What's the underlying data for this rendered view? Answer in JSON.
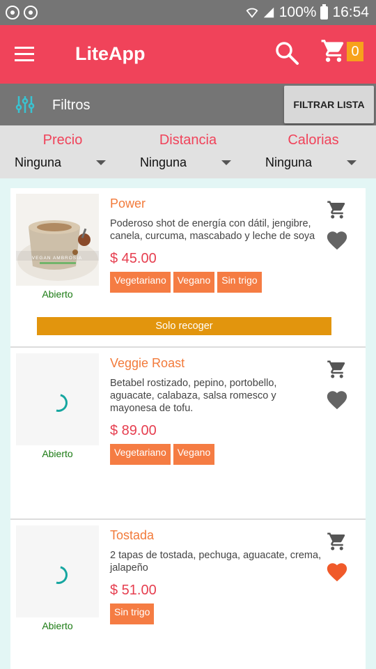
{
  "status": {
    "battery": "100%",
    "time": "16:54"
  },
  "appbar": {
    "title": "LiteApp",
    "cart_count": "0"
  },
  "filters": {
    "label": "Filtros",
    "button": "FILTRAR LISTA"
  },
  "dropdowns": [
    {
      "label": "Precio",
      "value": "Ninguna"
    },
    {
      "label": "Distancia",
      "value": "Ninguna"
    },
    {
      "label": "Calorias",
      "value": "Ninguna"
    }
  ],
  "items": [
    {
      "name": "Power",
      "description": "Poderoso shot de energía con dátil, jengibre, canela, curcuma, mascabado y leche de soya",
      "price": "$ 45.00",
      "tags": [
        "Vegetariano",
        "Vegano",
        "Sin trigo"
      ],
      "status": "Abierto",
      "pickup": "Solo recoger",
      "photo_text": "VEGAN AMBROSIA",
      "favorite": false
    },
    {
      "name": "Veggie Roast",
      "description": "Betabel rostizado, pepino, portobello, aguacate, calabaza, salsa romesco y mayonesa de tofu.",
      "price": "$ 89.00",
      "tags": [
        "Vegetariano",
        "Vegano"
      ],
      "status": "Abierto",
      "favorite": false
    },
    {
      "name": "Tostada",
      "description": "2 tapas de tostada, pechuga, aguacate, crema, jalapeño",
      "price": "$ 51.00",
      "tags": [
        "Sin trigo"
      ],
      "status": "Abierto",
      "favorite": true
    }
  ],
  "colors": {
    "primary": "#f0435a",
    "accent": "#f57c43",
    "favorite": "#f05a2a",
    "pickup": "#e2950d"
  }
}
